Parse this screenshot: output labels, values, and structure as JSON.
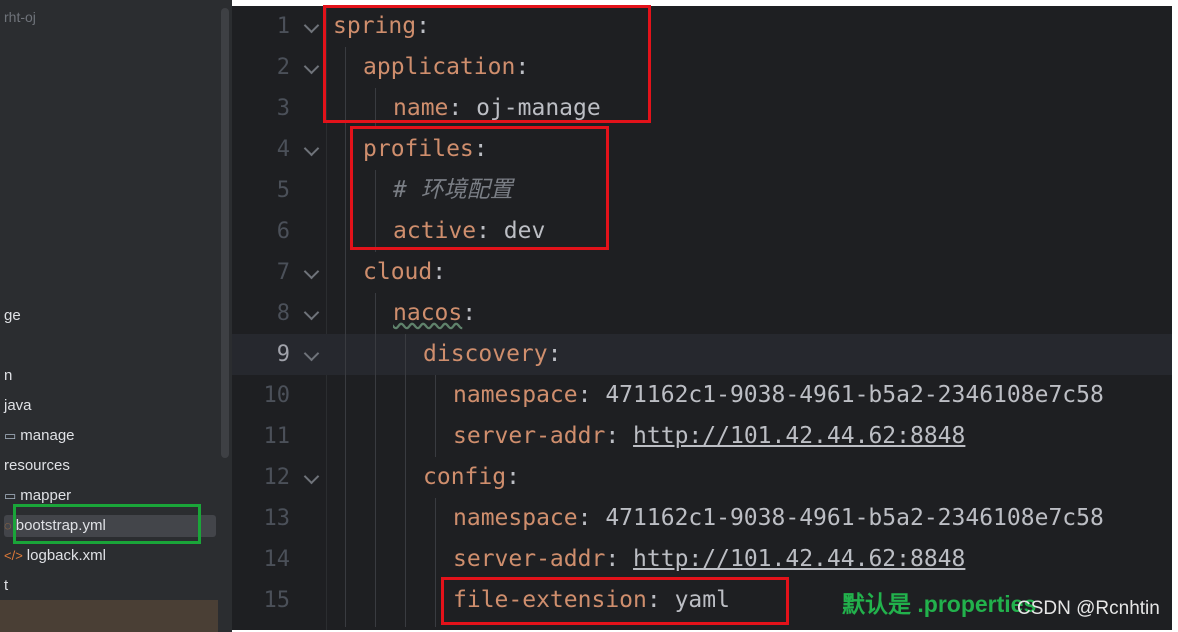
{
  "sidebar": {
    "project_name": "rht-oj",
    "items": [
      {
        "label": "ge",
        "icon": ""
      },
      {
        "label": "n",
        "icon": ""
      },
      {
        "label": "java",
        "icon": ""
      },
      {
        "label": "manage",
        "icon": "folder-icon"
      },
      {
        "label": "resources",
        "icon": ""
      },
      {
        "label": "mapper",
        "icon": "folder-icon"
      },
      {
        "label": "bootstrap.yml",
        "icon": "yaml-file-icon"
      },
      {
        "label": "logback.xml",
        "icon": "xml-file-icon"
      },
      {
        "label": "t",
        "icon": ""
      }
    ],
    "selected_item": "bootstrap.yml"
  },
  "editor": {
    "current_line": 9,
    "lines": [
      {
        "num": "1",
        "key": "spring",
        "colon": ":",
        "value": ""
      },
      {
        "num": "2",
        "key": "application",
        "colon": ":",
        "value": ""
      },
      {
        "num": "3",
        "key": "name",
        "colon": ":",
        "value": " oj-manage"
      },
      {
        "num": "4",
        "key": "profiles",
        "colon": ":",
        "value": ""
      },
      {
        "num": "5",
        "comment": "# 环境配置"
      },
      {
        "num": "6",
        "key": "active",
        "colon": ":",
        "value": " dev"
      },
      {
        "num": "7",
        "key": "cloud",
        "colon": ":",
        "value": ""
      },
      {
        "num": "8",
        "key": "nacos",
        "colon": ":",
        "value": ""
      },
      {
        "num": "9",
        "key": "discovery",
        "colon": ":",
        "value": ""
      },
      {
        "num": "10",
        "key": "namespace",
        "colon": ":",
        "value": " 471162c1-9038-4961-b5a2-2346108e7c58"
      },
      {
        "num": "11",
        "key": "server-addr",
        "colon": ":",
        "value": " ",
        "link": "http://101.42.44.62:8848"
      },
      {
        "num": "12",
        "key": "config",
        "colon": ":",
        "value": ""
      },
      {
        "num": "13",
        "key": "namespace",
        "colon": ":",
        "value": " 471162c1-9038-4961-b5a2-2346108e7c58"
      },
      {
        "num": "14",
        "key": "server-addr",
        "colon": ":",
        "value": " ",
        "link": "http://101.42.44.62:8848"
      },
      {
        "num": "15",
        "key": "file-extension",
        "colon": ":",
        "value": " yaml"
      }
    ]
  },
  "annotation": "默认是 .properties",
  "watermark": "CSDN @Rcnhtin",
  "colors": {
    "highlight_red": "#e3121a",
    "highlight_green": "#1aa539",
    "annotation_green": "#22b14c",
    "yaml_key": "#cf8e6d"
  }
}
